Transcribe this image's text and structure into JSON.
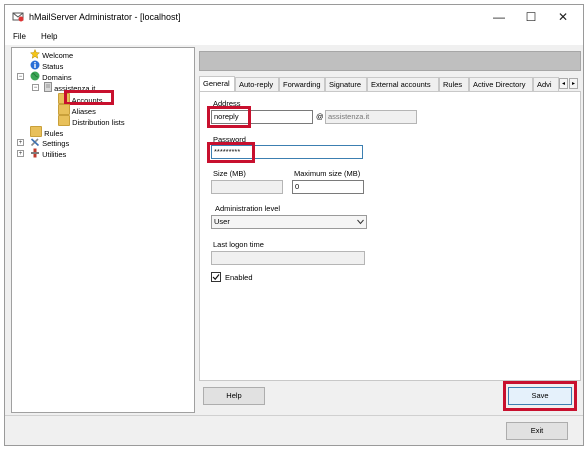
{
  "window": {
    "title": "hMailServer Administrator - [localhost]",
    "min": "—",
    "max": "☐",
    "close": "✕"
  },
  "menu": {
    "items": [
      "File",
      "Help"
    ]
  },
  "tree": {
    "welcome": "Welcome",
    "status": "Status",
    "domains": "Domains",
    "domain": "assistenza.it",
    "accounts": "Accounts",
    "aliases": "Aliases",
    "distribution_lists": "Distribution lists",
    "rules": "Rules",
    "settings": "Settings",
    "utilities": "Utilities"
  },
  "tabs": {
    "items": [
      "General",
      "Auto-reply",
      "Forwarding",
      "Signature",
      "External accounts",
      "Rules",
      "Active Directory",
      "Advi"
    ],
    "active": "General",
    "scroll_left": "◂",
    "scroll_right": "▸"
  },
  "form": {
    "address_label": "Address",
    "address_value": "noreply",
    "at": "@",
    "domain_value": "assistenza.it",
    "password_label": "Password",
    "password_value": "*********",
    "size_label": "Size (MB)",
    "size_value": "",
    "max_size_label": "Maximum size (MB)",
    "max_size_value": "0",
    "admin_level_label": "Administration level",
    "admin_level_value": "User",
    "last_logon_label": "Last logon time",
    "last_logon_value": "",
    "enabled_label": "Enabled",
    "enabled_checked": true
  },
  "buttons": {
    "help": "Help",
    "save": "Save",
    "exit": "Exit"
  },
  "colors": {
    "highlight": "#c8102e",
    "folder": "#e8c05a"
  }
}
